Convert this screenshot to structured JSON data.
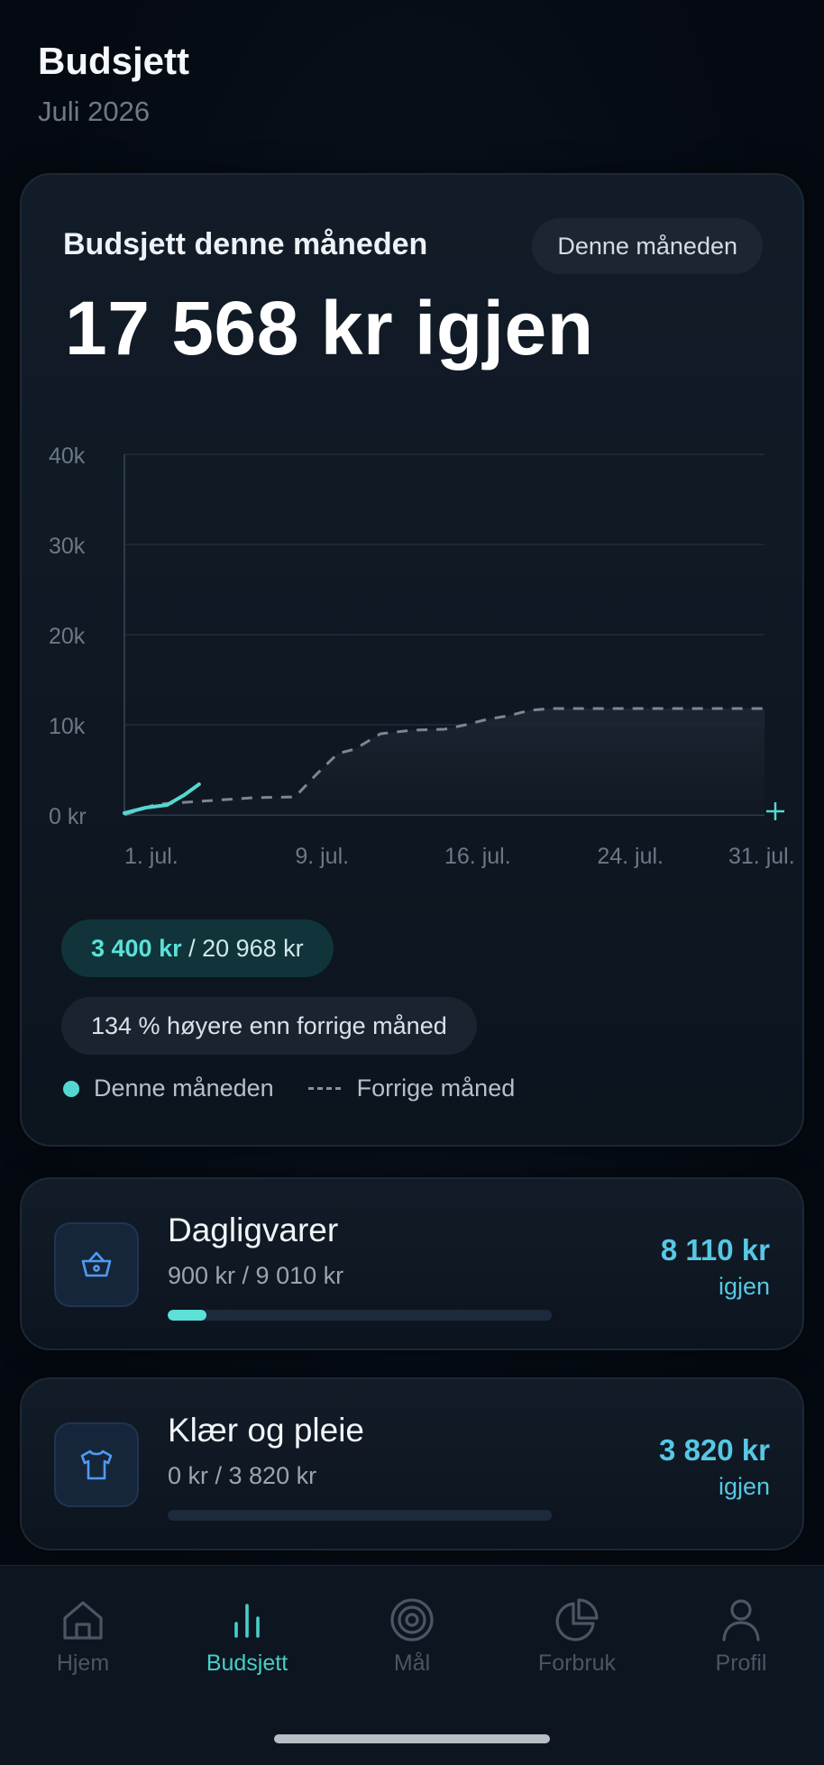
{
  "header": {
    "title": "Budsjett",
    "subtitle": "Juli 2026"
  },
  "budget": {
    "heading": "Budsjett denne måneden",
    "period_chip": "Denne måneden",
    "remaining": "17 568 kr igjen",
    "spent_amount": "3 400 kr",
    "spent_total": " / 20 968 kr",
    "comparison": "134 % høyere enn forrige måned",
    "legend_current": "Denne måneden",
    "legend_previous": "Forrige måned"
  },
  "chart_data": {
    "type": "line",
    "y_ticks": [
      "40k",
      "30k",
      "20k",
      "10k",
      "0 kr"
    ],
    "x_ticks": [
      "1. jul.",
      "9. jul.",
      "16. jul.",
      "24. jul.",
      "31. jul."
    ],
    "ylim": [
      0,
      40000
    ],
    "xlim": [
      1,
      31
    ],
    "grid": true,
    "series": [
      {
        "name": "Denne måneden",
        "color": "#53d8d1",
        "style": "solid",
        "x": [
          1,
          1.5,
          2,
          3,
          3.8,
          4.5
        ],
        "y": [
          200,
          500,
          800,
          1100,
          2200,
          3400
        ]
      },
      {
        "name": "Forrige måned",
        "color": "#7b8794",
        "style": "dashed",
        "x": [
          1,
          2.5,
          4.5,
          7,
          9,
          10,
          11,
          11.8,
          13,
          14.5,
          16,
          17,
          18,
          19,
          20,
          21,
          24,
          27,
          31
        ],
        "y": [
          0,
          1200,
          1500,
          1900,
          2000,
          4500,
          6800,
          7300,
          9000,
          9400,
          9500,
          10000,
          10600,
          11000,
          11600,
          11800,
          11800,
          11800,
          11800
        ]
      }
    ]
  },
  "categories": [
    {
      "icon": "basket-icon",
      "name": "Dagligvarer",
      "spent": "900 kr / 9 010 kr",
      "amount": "8 110 kr",
      "left_label": "igjen",
      "progress": 0.0999
    },
    {
      "icon": "tshirt-icon",
      "name": "Klær og pleie",
      "spent": "0 kr / 3 820 kr",
      "amount": "3 820 kr",
      "left_label": "igjen",
      "progress": 0
    }
  ],
  "tabs": [
    {
      "label": "Hjem",
      "icon": "home-icon",
      "active": false
    },
    {
      "label": "Budsjett",
      "icon": "bar-chart-icon",
      "active": true
    },
    {
      "label": "Mål",
      "icon": "target-icon",
      "active": false
    },
    {
      "label": "Forbruk",
      "icon": "pie-chart-icon",
      "active": false
    },
    {
      "label": "Profil",
      "icon": "person-icon",
      "active": false
    }
  ],
  "colors": {
    "accent": "#53d8d1",
    "amount": "#56c8e4",
    "background": "#050a12"
  }
}
